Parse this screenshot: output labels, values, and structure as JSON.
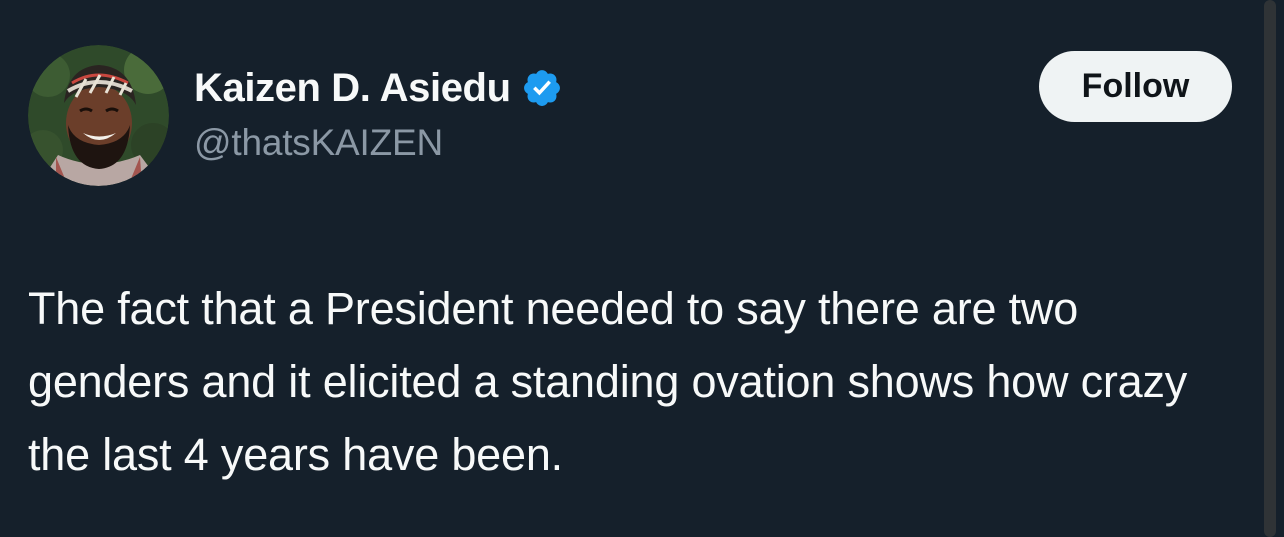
{
  "tweet": {
    "author": {
      "display_name": "Kaizen D. Asiedu",
      "handle": "@thatsKAIZEN",
      "verified": true,
      "avatar": "profile-photo"
    },
    "follow_label": "Follow",
    "text": "The fact that a President needed to say there are two genders and it elicited a standing ovation shows how crazy the last 4 years have been."
  },
  "colors": {
    "background": "#15202b",
    "text_primary": "#f7f9f9",
    "text_secondary": "#8b98a5",
    "verified_badge": "#1d9bf0",
    "button_bg": "#eff3f4",
    "button_text": "#0f1419"
  }
}
